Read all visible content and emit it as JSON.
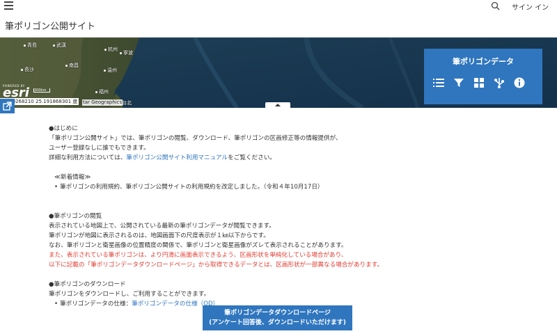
{
  "header": {
    "signin_label": "サイン イン",
    "site_title": "筆ポリゴン公開サイト"
  },
  "map": {
    "cities": [
      "青島",
      "武漢",
      "杭州",
      "寧波",
      "長沙",
      "南昌",
      "温州",
      "福州",
      "台北"
    ],
    "esri_powered": "POWERED BY",
    "esri_logo": "esri",
    "scale_label": "300km",
    "coordinates": "0.479268210 25.191868301 度",
    "attribution": "tar Geographics"
  },
  "panel": {
    "title": "筆ポリゴンデータ",
    "tools": [
      "list-icon",
      "filter-icon",
      "grid-icon",
      "share-nodes-icon",
      "info-icon"
    ]
  },
  "content": {
    "intro_heading": "●はじめに",
    "intro_line1": "「筆ポリゴン公開サイト」では、筆ポリゴンの閲覧、ダウンロード、筆ポリゴンの区画修正等の情報提供が、",
    "intro_line2": "ユーザー登録なしに誰でもできます。",
    "intro_line3_pre": "詳細な利用方法については、",
    "intro_line3_link": "筆ポリゴン公開サイト利用マニュアル",
    "intro_line3_post": "をご覧ください。",
    "news_heading": "≪新着情報≫",
    "news_item": "筆ポリゴンの利用規約、筆ポリゴン公開サイトの利用規約を改定しました。（令和４年10月17日）",
    "view_heading": "●筆ポリゴンの閲覧",
    "view_line1": "表示されている地図上で、公開されている最新の筆ポリゴンデータが閲覧できます。",
    "view_line2": "筆ポリゴンが地図に表示されるのは、地図画面下の尺度表示が１㎞以下からです。",
    "view_line3": "なお、筆ポリゴンと衛星画像の位置精度の関係で、筆ポリゴンと衛星画像がズレて表示されることがあります。",
    "view_red1": "また、表示されている筆ポリゴンは、より円滑に画面表示できるよう、区画形状を単純化している場合があり、",
    "view_red2": "以下に記載の「筆ポリゴンデータダウンロードページ」から取得できるデータとは、区画形状が一部異なる場合があります。",
    "dl_heading": "●筆ポリゴンのダウンロード",
    "dl_line1": "筆ポリゴンをダウンロードし、ご利用することができます。",
    "dl_item_pre": "筆ポリゴンデータの仕様：",
    "dl_item_link": "筆ポリゴンデータの仕様（OD）",
    "dl_button_line1": "筆ポリゴンデータダウンロードページ",
    "dl_button_line2": "(アンケート回答後、ダウンロードいただけます)"
  }
}
